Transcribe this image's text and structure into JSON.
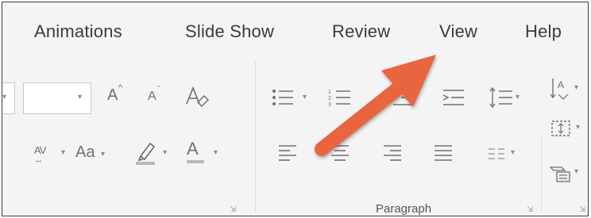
{
  "tabs": [
    {
      "label": "Animations"
    },
    {
      "label": "Slide Show"
    },
    {
      "label": "Review"
    },
    {
      "label": "View"
    },
    {
      "label": "Help"
    }
  ],
  "ribbon": {
    "paragraph_group_label": "Paragraph",
    "icons": {
      "increase_font": "A",
      "decrease_font": "A",
      "change_case": "Aa",
      "font_color": "A",
      "char_spacing": "AV"
    }
  },
  "annotation": {
    "arrow_color": "#e8653f"
  }
}
